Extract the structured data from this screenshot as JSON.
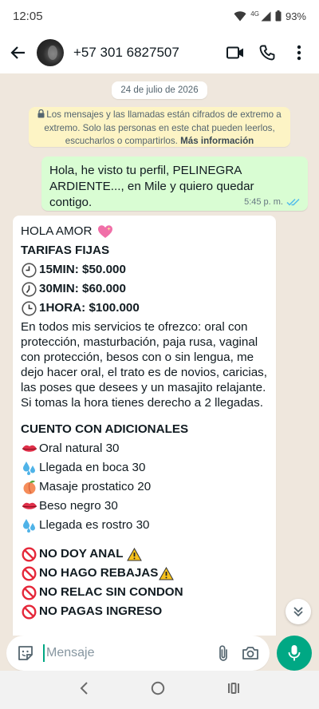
{
  "status": {
    "time": "12:05",
    "network": "4G",
    "battery": "93%"
  },
  "header": {
    "contact_name": "+57 301 6827507"
  },
  "chat": {
    "date_chip": "24 de julio de 2026",
    "encryption_text": "Los mensajes y las llamadas están cifrados de extremo a extremo. Solo las personas en este chat pueden leerlos, escucharlos o compartirlos.",
    "encryption_link": "Más información",
    "outgoing": {
      "text": "Hola, he visto tu perfil, PELINEGRA ARDIENTE..., en Mile y quiero quedar contigo.",
      "time": "5:45 p. m."
    },
    "incoming": {
      "greeting": "HOLA AMOR",
      "rates_title": "TARIFAS FIJAS",
      "rates": [
        "15MIN: $50.000",
        "30MIN: $60.000",
        "1HORA: $100.000"
      ],
      "description": "En todos mis servicios te ofrezco: oral con protección, masturbación, paja rusa, vaginal con protección, besos con o sin lengua, me dejo hacer oral, el trato es de novios, caricias, las poses que desees y un masajito relajante. Si tomas la hora tienes derecho a 2 llegadas.",
      "extras_title": "CUENTO CON ADICIONALES",
      "extras": [
        {
          "icon": "lips-icon",
          "text": "Oral natural 30"
        },
        {
          "icon": "droplets-icon",
          "text": "Llegada en boca 30"
        },
        {
          "icon": "peach-icon",
          "text": "Masaje prostatico 20"
        },
        {
          "icon": "lips-icon",
          "text": "Beso negro 30"
        },
        {
          "icon": "droplets-icon",
          "text": "Llegada es rostro 30"
        }
      ],
      "rules": [
        "NO DOY ANAL",
        "NO HAGO REBAJAS",
        "NO RELAC SIN CONDON",
        "NO PAGAS INGRESO"
      ]
    }
  },
  "composer": {
    "placeholder": "Mensaje"
  },
  "colors": {
    "accent": "#00a884",
    "outgoing_bubble": "#d9fdd3",
    "chat_bg": "#efe7dd",
    "read_ticks": "#53bdeb"
  }
}
